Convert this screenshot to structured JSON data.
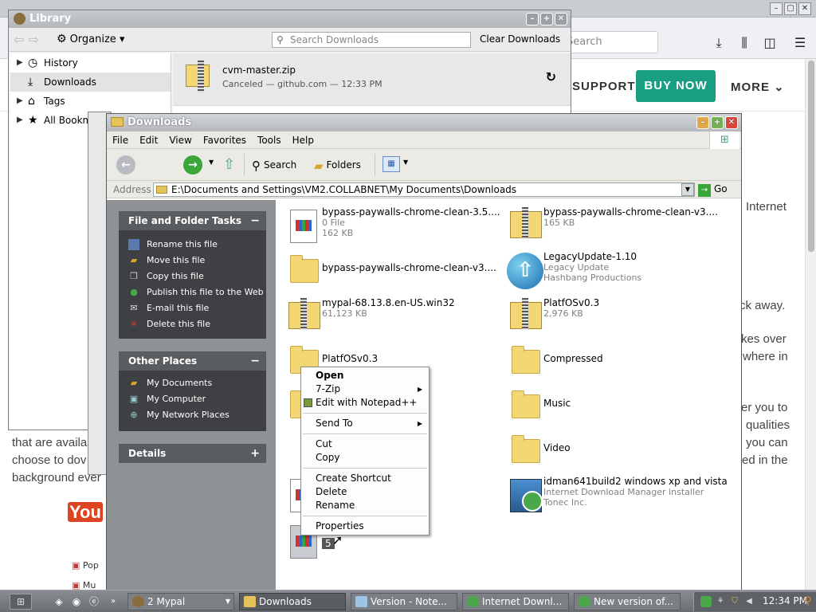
{
  "background_page": {
    "search_placeholder": "Search",
    "nav": {
      "support": "SUPPORT",
      "buy_now": "BUY NOW",
      "more": "MORE"
    },
    "text_fragments": [
      "Internet",
      "ck away.",
      "kes over",
      "where in",
      "er you to",
      "qualities",
      "you can",
      "ed in the",
      "that are availa",
      "choose to dov",
      "background ever"
    ],
    "youtube_logo": "You",
    "youtube_items": [
      "Pop",
      "Mu"
    ],
    "colors": {
      "buy_now": "#1a9e82"
    }
  },
  "library": {
    "title": "Library",
    "organize": "Organize",
    "search_placeholder": "Search Downloads",
    "clear_downloads": "Clear Downloads",
    "tree": [
      {
        "label": "History",
        "icon": "clock-icon",
        "expander": "›"
      },
      {
        "label": "Downloads",
        "icon": "download-icon",
        "selected": true
      },
      {
        "label": "Tags",
        "icon": "tag-icon",
        "expander": "›"
      },
      {
        "label": "All Bookm",
        "icon": "star-icon",
        "expander": "›"
      }
    ],
    "download": {
      "name": "cvm-master.zip",
      "status": "Canceled — github.com — 12:33 PM",
      "icon": "zip-file-icon"
    }
  },
  "explorer": {
    "title": "Downloads",
    "menu": [
      "File",
      "Edit",
      "View",
      "Favorites",
      "Tools",
      "Help"
    ],
    "toolbar": {
      "search": "Search",
      "folders": "Folders"
    },
    "address": {
      "label": "Address",
      "value": "E:\\Documents and Settings\\VM2.COLLABNET\\My Documents\\Downloads",
      "go": "Go"
    },
    "tasks_panel": {
      "title": "File and Folder Tasks",
      "toggle": "−",
      "items": [
        "Rename this file",
        "Move this file",
        "Copy this file",
        "Publish this file to the Web",
        "E-mail this file",
        "Delete this file"
      ]
    },
    "places_panel": {
      "title": "Other Places",
      "toggle": "−",
      "items": [
        "My Documents",
        "My Computer",
        "My Network Places"
      ]
    },
    "details_panel": {
      "title": "Details",
      "toggle": "+"
    },
    "files": [
      {
        "name": "bypass-paywalls-chrome-clean-3.5....",
        "l2": "0 File",
        "l3": "162 KB",
        "type": "doc"
      },
      {
        "name": "bypass-paywalls-chrome-clean-v3....",
        "l2": "165 KB",
        "l3": "",
        "type": "zip"
      },
      {
        "name": "bypass-paywalls-chrome-clean-v3....",
        "l2": "",
        "l3": "",
        "type": "folder"
      },
      {
        "name": "LegacyUpdate-1.10",
        "l2": "Legacy Update",
        "l3": "Hashbang Productions",
        "type": "globe"
      },
      {
        "name": "mypal-68.13.8.en-US.win32",
        "l2": "61,123 KB",
        "l3": "",
        "type": "zip"
      },
      {
        "name": "PlatfOSv0.3",
        "l2": "2,976 KB",
        "l3": "",
        "type": "zip"
      },
      {
        "name": "PlatfOSv0.3",
        "l2": "",
        "l3": "",
        "type": "folder"
      },
      {
        "name": "Compressed",
        "l2": "",
        "l3": "",
        "type": "folder"
      },
      {
        "name": "Music",
        "l2": "",
        "l3": "",
        "type": "folder"
      },
      {
        "name": "Video",
        "l2": "",
        "l3": "",
        "type": "folder"
      },
      {
        "name": "idman641build2 windows xp and vista",
        "l2": "Internet Download Manager installer",
        "l3": "Tonec Inc.",
        "type": "idm"
      }
    ],
    "selected_partial_label": "5"
  },
  "context_menu": {
    "items": [
      {
        "label": "Open",
        "bold": true
      },
      {
        "label": "7-Zip",
        "submenu": true
      },
      {
        "label": "Edit with Notepad++"
      },
      {
        "label": "Send To",
        "submenu": true
      },
      {
        "label": "Cut"
      },
      {
        "label": "Copy"
      },
      {
        "label": "Create Shortcut"
      },
      {
        "label": "Delete"
      },
      {
        "label": "Rename"
      },
      {
        "label": "Properties"
      }
    ]
  },
  "taskbar": {
    "tasks": [
      {
        "label": "2 Mypal",
        "icon": "mypal-icon"
      },
      {
        "label": "Downloads",
        "icon": "folder-icon",
        "active": true
      },
      {
        "label": "Version - Note...",
        "icon": "notepad-icon"
      },
      {
        "label": "Internet Downl...",
        "icon": "idm-icon"
      },
      {
        "label": "New version of...",
        "icon": "idm-icon"
      }
    ],
    "clock": "12:34 PM"
  }
}
